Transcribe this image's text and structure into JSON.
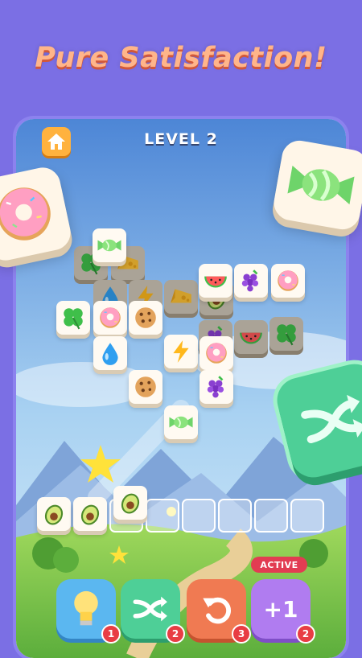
{
  "headline": "Pure Satisfaction!",
  "level": {
    "title": "LEVEL 2"
  },
  "home_button": {
    "icon": "home-icon"
  },
  "board_tiles": [
    {
      "icon": "candy-icon"
    },
    {
      "icon": "clover-icon"
    },
    {
      "icon": "cheese-icon"
    },
    {
      "icon": "watermelon-icon"
    },
    {
      "icon": "grapes-icon"
    },
    {
      "icon": "donut-icon"
    },
    {
      "icon": "water-drop-icon"
    },
    {
      "icon": "lightning-icon"
    },
    {
      "icon": "cheese-icon"
    },
    {
      "icon": "clover-icon"
    },
    {
      "icon": "donut-icon"
    },
    {
      "icon": "cookie-icon"
    },
    {
      "icon": "grapes-icon"
    },
    {
      "icon": "watermelon-icon"
    },
    {
      "icon": "clover-icon"
    },
    {
      "icon": "water-drop-icon"
    },
    {
      "icon": "lightning-icon"
    },
    {
      "icon": "donut-icon"
    },
    {
      "icon": "cookie-icon"
    },
    {
      "icon": "grapes-icon"
    },
    {
      "icon": "candy-icon"
    },
    {
      "icon": "avocado-icon"
    }
  ],
  "tray": {
    "filled": [
      {
        "icon": "avocado-icon"
      },
      {
        "icon": "avocado-icon"
      },
      {
        "icon": "avocado-icon"
      }
    ],
    "capacity": 8
  },
  "boosters": [
    {
      "name": "hint",
      "icon": "lightbulb-icon",
      "count": "1",
      "color": "#5bb7f0"
    },
    {
      "name": "shuffle",
      "icon": "shuffle-icon",
      "count": "2",
      "color": "#4ecf97"
    },
    {
      "name": "undo",
      "icon": "undo-icon",
      "count": "3",
      "color": "#f07a52"
    },
    {
      "name": "extra-slot",
      "icon": "plus-one-icon",
      "label": "+1",
      "count": "2",
      "color": "#b07cf0",
      "tag": "ACTIVE"
    }
  ],
  "colors": {
    "background": "#7b6fe4",
    "headline": "#ffb58a",
    "tile": "#fffaf2"
  }
}
